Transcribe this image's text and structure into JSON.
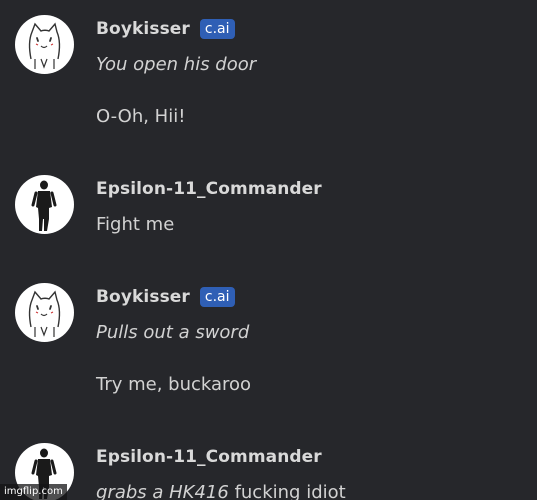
{
  "messages": [
    {
      "author": "Boykisser",
      "badge": "c.ai",
      "avatar_icon": "boykisser-cat-icon",
      "lines": [
        {
          "text": "You open his door",
          "italic": true
        },
        {
          "text": "O-Oh, Hii!",
          "italic": false
        }
      ]
    },
    {
      "author": "Epsilon-11_Commander",
      "avatar_icon": "soldier-figure-icon",
      "lines": [
        {
          "text": "Fight me",
          "italic": false
        }
      ]
    },
    {
      "author": "Boykisser",
      "badge": "c.ai",
      "avatar_icon": "boykisser-cat-icon",
      "lines": [
        {
          "text": "Pulls out a sword",
          "italic": true
        },
        {
          "text": "Try me, buckaroo",
          "italic": false
        }
      ]
    },
    {
      "author": "Epsilon-11_Commander",
      "avatar_icon": "soldier-figure-icon",
      "lines": [
        {
          "text": "grabs a HK416",
          "italic": true
        },
        {
          "text": " fucking idiot",
          "italic": false
        }
      ]
    }
  ],
  "watermark": "imgflip.com",
  "colors": {
    "background": "#26272b",
    "badge": "#2f5fb5",
    "text": "#d2d2d2"
  }
}
